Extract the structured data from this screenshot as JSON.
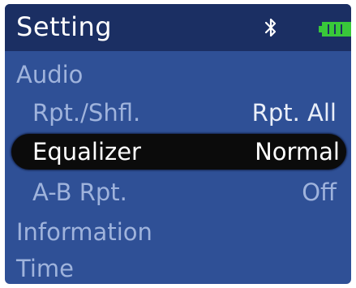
{
  "header": {
    "title": "Setting",
    "icons": [
      "bluetooth-icon",
      "battery-icon"
    ]
  },
  "menu": {
    "items": [
      {
        "label": "Audio",
        "value": ""
      },
      {
        "label": "Rpt./Shfl.",
        "value": "Rpt. All"
      },
      {
        "label": "Equalizer",
        "value": "Normal",
        "selected": true
      },
      {
        "label": "A-B Rpt.",
        "value": "Off"
      },
      {
        "label": "Information",
        "value": ""
      },
      {
        "label": "Time",
        "value": ""
      }
    ]
  },
  "colors": {
    "background": "#2f5096",
    "header": "#1b2f63",
    "highlight": "#0b0b0b",
    "text_dim": "#9fb3dc",
    "text_bright": "#ffffff",
    "battery": "#39c83a"
  },
  "battery_level": 1.0
}
